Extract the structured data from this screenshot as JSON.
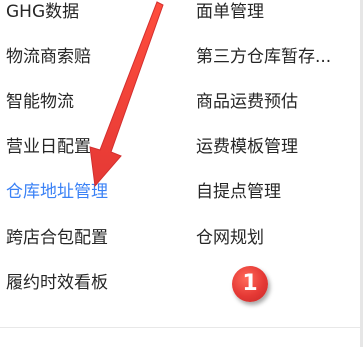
{
  "menu": {
    "left": [
      {
        "label": "GHG数据"
      },
      {
        "label": "物流商索赔"
      },
      {
        "label": "智能物流"
      },
      {
        "label": "营业日配置"
      },
      {
        "label": "仓库地址管理"
      },
      {
        "label": "跨店合包配置"
      },
      {
        "label": "履约时效看板"
      }
    ],
    "right": [
      {
        "label": "面单管理"
      },
      {
        "label": "第三方仓库暂存..."
      },
      {
        "label": "商品运费预估"
      },
      {
        "label": "运费模板管理"
      },
      {
        "label": "自提点管理"
      },
      {
        "label": "仓网规划"
      }
    ],
    "active_label": "仓库地址管理"
  },
  "annotation": {
    "step_number": "1",
    "arrow_color": "#e53935"
  },
  "colors": {
    "text": "#262626",
    "active": "#3b82f6",
    "badge": "#e53935"
  }
}
